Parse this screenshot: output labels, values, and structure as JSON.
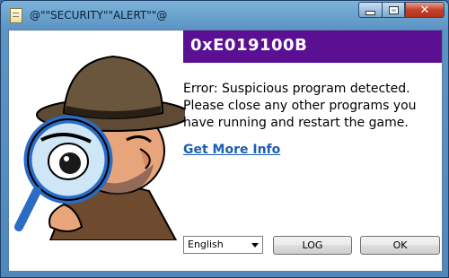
{
  "window": {
    "title": "@\"\"SECURITY\"\"ALERT\"\"@",
    "controls": {
      "minimize": "",
      "maximize": "",
      "close": "✕"
    }
  },
  "dialog": {
    "error_code": "0xE019100B",
    "message": "Error: Suspicious program detected. Please close any other programs you have running and restart the game.",
    "link_text": "Get More Info"
  },
  "footer": {
    "language_selected": "English",
    "log_label": "LOG",
    "ok_label": "OK"
  },
  "colors": {
    "header_bg": "#5b0f92",
    "link": "#1a5fb4",
    "close_button": "#c4432a"
  },
  "icons": [
    "document-icon",
    "detective-magnifier-illustration",
    "chevron-down-icon"
  ]
}
